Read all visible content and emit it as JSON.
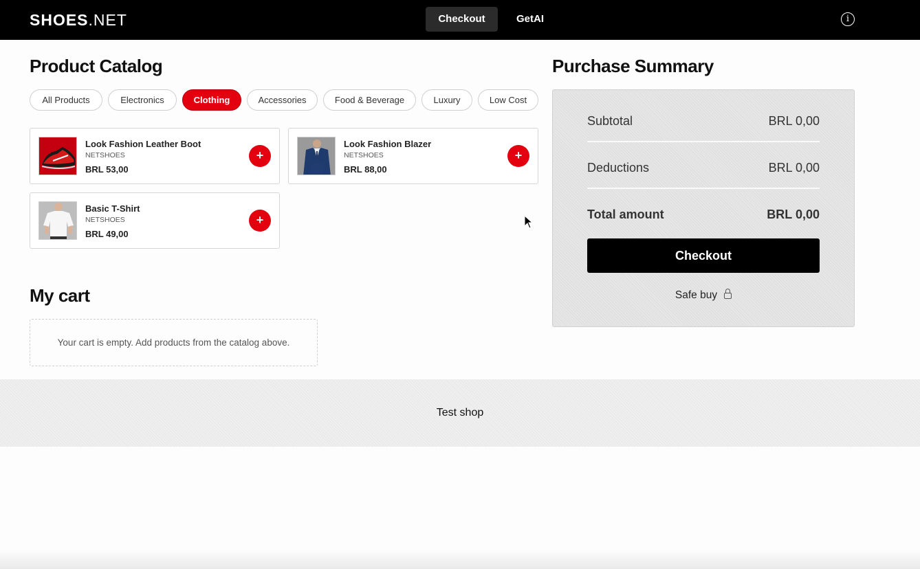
{
  "header": {
    "logo_bold": "SHOES",
    "logo_rest": ".NET",
    "nav": [
      "Checkout",
      "GetAI"
    ],
    "info_glyph": "i"
  },
  "catalog": {
    "title": "Product Catalog",
    "filters": [
      "All Products",
      "Electronics",
      "Clothing",
      "Accessories",
      "Food & Beverage",
      "Luxury",
      "Low Cost"
    ],
    "active_filter": "Clothing",
    "add_glyph": "+",
    "products": [
      {
        "name": "Look Fashion Leather Boot",
        "brand": "NETSHOES",
        "price": "BRL 53,00",
        "image": "red-sneaker-image"
      },
      {
        "name": "Look Fashion Blazer",
        "brand": "NETSHOES",
        "price": "BRL 88,00",
        "image": "blue-suit-image"
      },
      {
        "name": "Basic T-Shirt",
        "brand": "NETSHOES",
        "price": "BRL 49,00",
        "image": "white-tshirt-image"
      }
    ]
  },
  "cart": {
    "title": "My cart",
    "empty_text": "Your cart is empty. Add products from the catalog above."
  },
  "summary": {
    "title": "Purchase Summary",
    "subtotal_label": "Subtotal",
    "subtotal_value": "BRL 0,00",
    "deductions_label": "Deductions",
    "deductions_value": "BRL 0,00",
    "total_label": "Total amount",
    "total_value": "BRL 0,00",
    "checkout_label": "Checkout",
    "safe_label": "Safe buy"
  },
  "footer": {
    "text": "Test shop"
  },
  "colors": {
    "accent_red": "#e3000f",
    "header_bg": "#000000"
  }
}
